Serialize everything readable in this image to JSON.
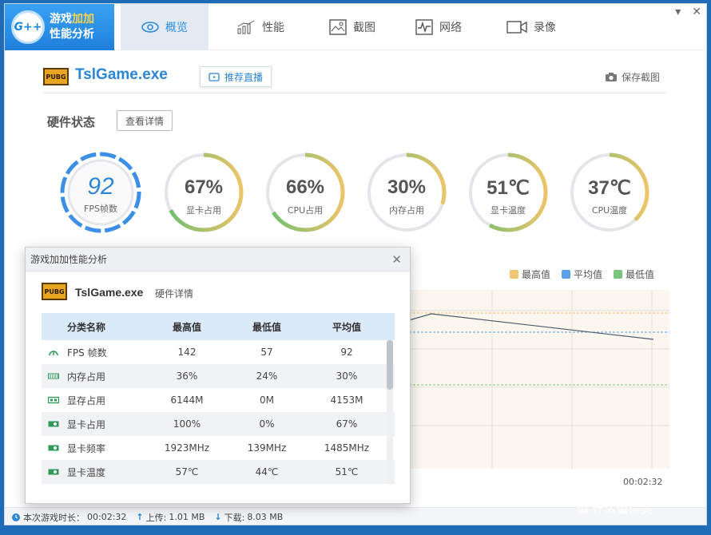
{
  "app": {
    "logo_badge": "G++",
    "logo_line1a": "游戏",
    "logo_line1b": "加加",
    "logo_line2": "性能分析"
  },
  "tabs": [
    {
      "label": "概览",
      "icon": "eye-icon",
      "active": true
    },
    {
      "label": "性能",
      "icon": "bar-chart-icon",
      "active": false
    },
    {
      "label": "截图",
      "icon": "image-icon",
      "active": false
    },
    {
      "label": "网络",
      "icon": "pulse-icon",
      "active": false
    },
    {
      "label": "录像",
      "icon": "video-camera-icon",
      "active": false
    }
  ],
  "window_controls": {
    "minimize": "▾",
    "close": "✕"
  },
  "game": {
    "badge": "PUBG",
    "name": "TslGame.exe",
    "recommend_live": "推荐直播",
    "save_screenshot": "保存截图"
  },
  "hardware": {
    "title": "硬件状态",
    "detail_button": "查看详情"
  },
  "gauges": [
    {
      "value": "92",
      "label": "FPS帧数",
      "kind": "fps",
      "fraction": 1.0
    },
    {
      "value": "67%",
      "label": "显卡占用",
      "kind": "ring",
      "fraction": 0.67
    },
    {
      "value": "66%",
      "label": "CPU占用",
      "kind": "ring",
      "fraction": 0.66
    },
    {
      "value": "30%",
      "label": "内存占用",
      "kind": "ring",
      "fraction": 0.3
    },
    {
      "value": "51℃",
      "label": "显卡温度",
      "kind": "ring",
      "fraction": 0.58
    },
    {
      "value": "37℃",
      "label": "CPU温度",
      "kind": "ring",
      "fraction": 0.38
    }
  ],
  "legend": [
    {
      "label": "最高值",
      "color": "#f0c674"
    },
    {
      "label": "平均值",
      "color": "#5aa0ea"
    },
    {
      "label": "最低值",
      "color": "#7bc47f"
    }
  ],
  "chart_time": "00:02:32",
  "status": {
    "duration_label": "本次游戏时长：",
    "duration": "00:02:32",
    "upload_label": "上传:",
    "upload": "1.01 MB",
    "download_label": "下载:",
    "download": "8.03 MB"
  },
  "popup": {
    "title": "游戏加加性能分析",
    "close": "✕",
    "badge": "PUBG",
    "game": "TslGame.exe",
    "subtitle": "硬件详情",
    "columns": [
      "分类名称",
      "最高值",
      "最低值",
      "平均值"
    ],
    "rows": [
      {
        "name": "FPS 帧数",
        "max": "142",
        "min": "57",
        "avg": "92",
        "icon": "gauge-icon"
      },
      {
        "name": "内存占用",
        "max": "36%",
        "min": "24%",
        "avg": "30%",
        "icon": "memory-icon"
      },
      {
        "name": "显存占用",
        "max": "6144M",
        "min": "0M",
        "avg": "4153M",
        "icon": "vram-icon"
      },
      {
        "name": "显卡占用",
        "max": "100%",
        "min": "0%",
        "avg": "67%",
        "icon": "gpu-icon"
      },
      {
        "name": "显卡频率",
        "max": "1923MHz",
        "min": "139MHz",
        "avg": "1485MHz",
        "icon": "gpu-icon"
      },
      {
        "name": "显卡温度",
        "max": "57℃",
        "min": "44℃",
        "avg": "51℃",
        "icon": "gpu-icon"
      }
    ]
  },
  "watermark": "值 什么值得买"
}
